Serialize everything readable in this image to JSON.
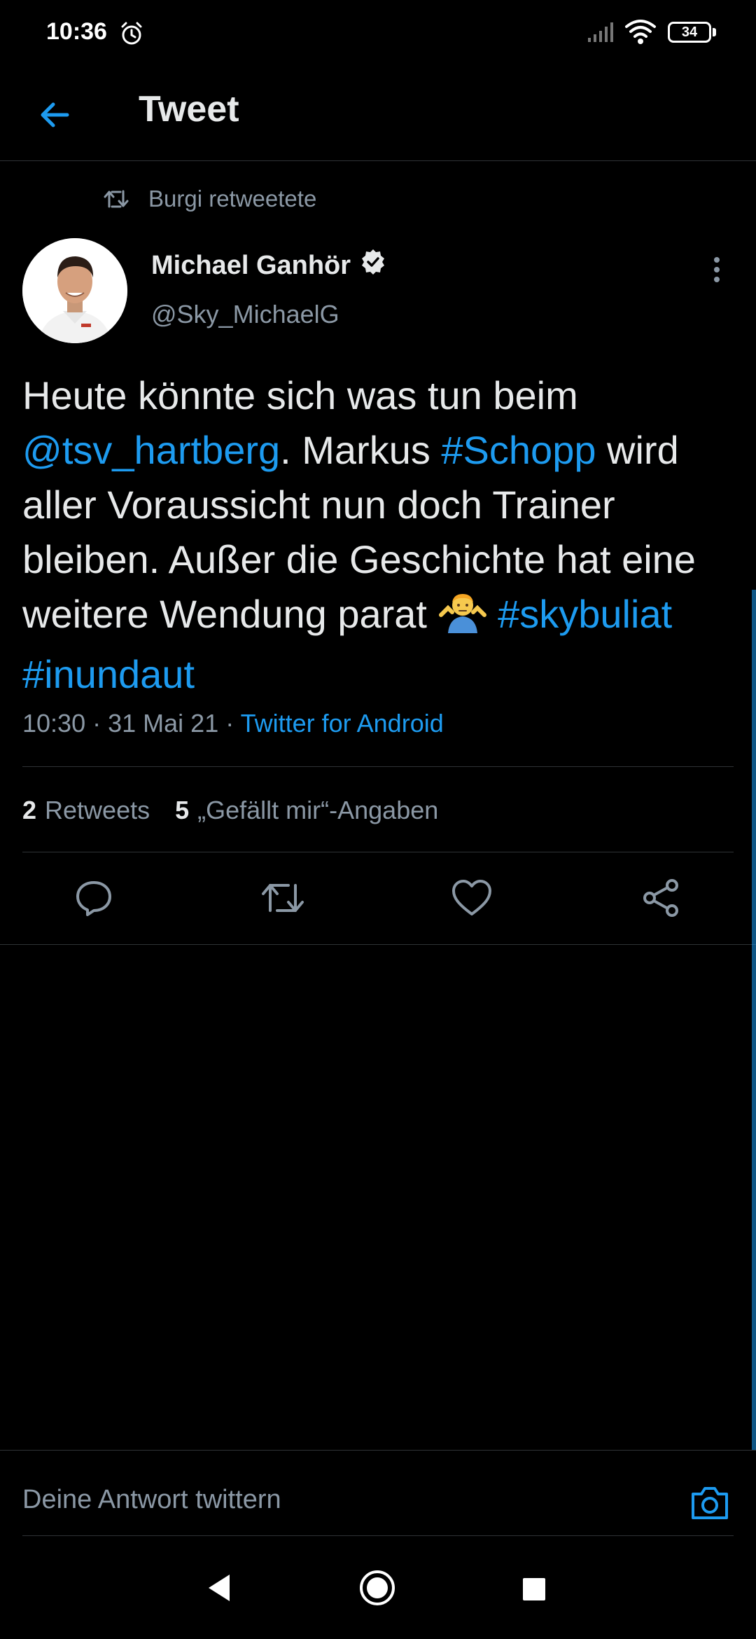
{
  "status_bar": {
    "time": "10:36",
    "battery": "34"
  },
  "header": {
    "title": "Tweet"
  },
  "retweet": {
    "label": "Burgi retweetete"
  },
  "author": {
    "name": "Michael Ganhör",
    "handle": "@Sky_MichaelG",
    "verified": true
  },
  "tweet": {
    "t1": "Heute könnte sich was tun beim ",
    "mention": "@tsv_hartberg",
    "t2": ". Markus ",
    "hashtag1": "#Schopp",
    "t3": " wird aller Voraussicht nun doch Trainer bleiben. Außer die Geschichte hat eine weitere Wendung parat ",
    "hashtag2": "#skybuliat",
    "hashtag3": "#inundaut"
  },
  "meta": {
    "time": "10:30",
    "date": "31 Mai 21",
    "source": "Twitter for Android"
  },
  "stats": {
    "retweets_count": "2",
    "retweets_label": "Retweets",
    "likes_count": "5",
    "likes_label": "„Gefällt mir“-Angaben"
  },
  "reply": {
    "placeholder": "Deine Antwort twittern"
  },
  "colors": {
    "accent": "#1d9bf0",
    "background": "#000000",
    "secondary_text": "#8b98a5"
  },
  "icons": {
    "back": "arrow-left-icon",
    "retweet": "retweet-icon",
    "more": "more-vertical-icon",
    "reply": "reply-icon",
    "like": "heart-icon",
    "share": "share-icon",
    "camera": "camera-icon"
  }
}
